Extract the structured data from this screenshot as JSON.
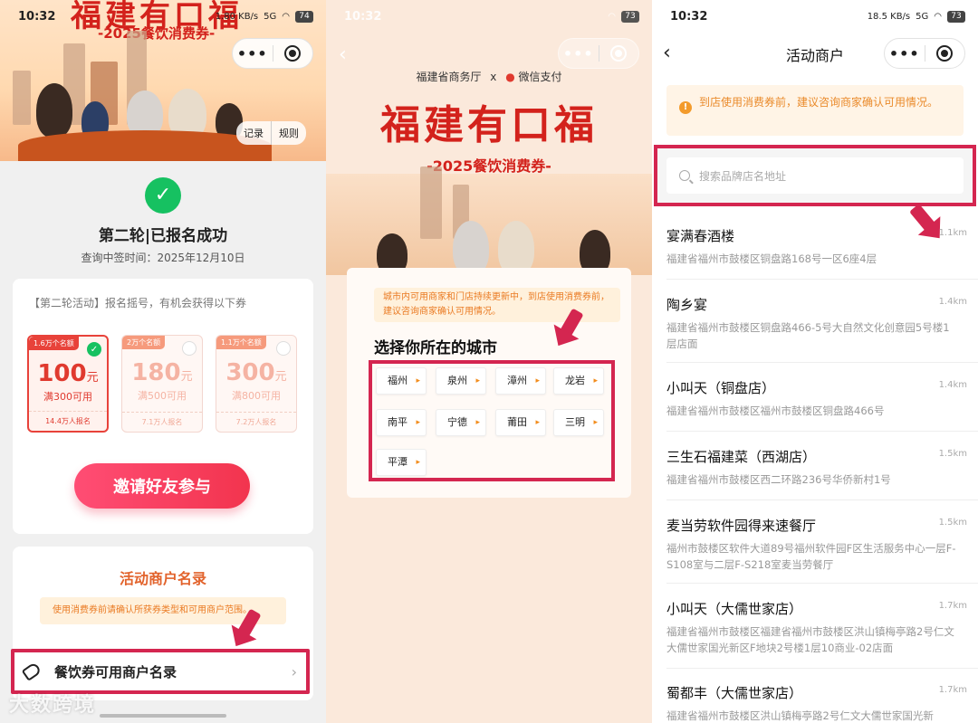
{
  "status": {
    "p1": {
      "time": "10:32",
      "net": "1.80 KB/s",
      "sig": "5G",
      "battery": "74"
    },
    "p2": {
      "time": "10:32",
      "battery": "73"
    },
    "p3": {
      "time": "10:32",
      "net": "18.5 KB/s",
      "sig": "5G",
      "battery": "73"
    }
  },
  "p1": {
    "banner_title": "福建有口福",
    "banner_sub": "-2025餐饮消费券-",
    "link_records": "记录",
    "link_rules": "规则",
    "success_title": "第二轮|已报名成功",
    "success_time": "查询中签时间：2025年12月10日",
    "intro": "【第二轮活动】报名摇号，有机会获得以下券",
    "coupons": [
      {
        "tag": "1.6万个名额",
        "amount": "100",
        "unit": "元",
        "cond": "满300可用",
        "signed": "14.4万人报名"
      },
      {
        "tag": "2万个名额",
        "amount": "180",
        "unit": "元",
        "cond": "满500可用",
        "signed": "7.1万人报名"
      },
      {
        "tag": "1.1万个名额",
        "amount": "300",
        "unit": "元",
        "cond": "满800可用",
        "signed": "7.2万人报名"
      }
    ],
    "invite_label": "邀请好友参与",
    "merchant_title": "活动商户名录",
    "merchant_note": "使用消费券前请确认所获券类型和可用商户范围。",
    "merchant_row_label": "餐饮券可用商户名录",
    "watermark": "大数跨境"
  },
  "p2": {
    "header_left": "福建省商务厅",
    "header_x": "x",
    "header_right": "微信支付",
    "logo": "福建有口福",
    "sub": "-2025餐饮消费券-",
    "note": "城市内可用商家和门店持续更新中，到店使用消费券前，建议咨询商家确认可用情况。",
    "heading": "选择你所在的城市",
    "cities": [
      "福州",
      "泉州",
      "漳州",
      "龙岩",
      "南平",
      "宁德",
      "莆田",
      "三明",
      "平潭"
    ]
  },
  "p3": {
    "title": "活动商户",
    "tip": "到店使用消费券前，建议咨询商家确认可用情况。",
    "search_placeholder": "搜索品牌店名地址",
    "merchants": [
      {
        "name": "宴满春酒楼",
        "dist": "1.1km",
        "addr": "福建省福州市鼓楼区铜盘路168号一区6座4层"
      },
      {
        "name": "陶乡宴",
        "dist": "1.4km",
        "addr": "福建省福州市鼓楼区铜盘路466-5号大自然文化创意园5号楼1层店面"
      },
      {
        "name": "小叫天（铜盘店）",
        "dist": "1.4km",
        "addr": "福建省福州市鼓楼区福州市鼓楼区铜盘路466号"
      },
      {
        "name": "三生石福建菜（西湖店）",
        "dist": "1.5km",
        "addr": "福建省福州市鼓楼区西二环路236号华侨新村1号"
      },
      {
        "name": "麦当劳软件园得来速餐厅",
        "dist": "1.5km",
        "addr": "福州市鼓楼区软件大道89号福州软件园F区生活服务中心一层F-S108室与二层F-S218室麦当劳餐厅"
      },
      {
        "name": "小叫天（大儒世家店）",
        "dist": "1.7km",
        "addr": "福建省福州市鼓楼区福建省福州市鼓楼区洪山镇梅亭路2号仁文大儒世家国光新区F地块2号楼1层10商业-02店面"
      },
      {
        "name": "蜀都丰（大儒世家店）",
        "dist": "1.7km",
        "addr": "福建省福州市鼓楼区洪山镇梅亭路2号仁文大儒世家国光新"
      }
    ]
  },
  "colors": {
    "highlight": "#d42650",
    "brand_red": "#d3221c",
    "success": "#16c161",
    "orange": "#ea7a22"
  },
  "icons": [
    "check-icon",
    "tag-icon",
    "chevron-right-icon",
    "back-icon",
    "more-icon",
    "target-icon",
    "search-icon",
    "info-icon",
    "arrow-pointer-icon"
  ]
}
